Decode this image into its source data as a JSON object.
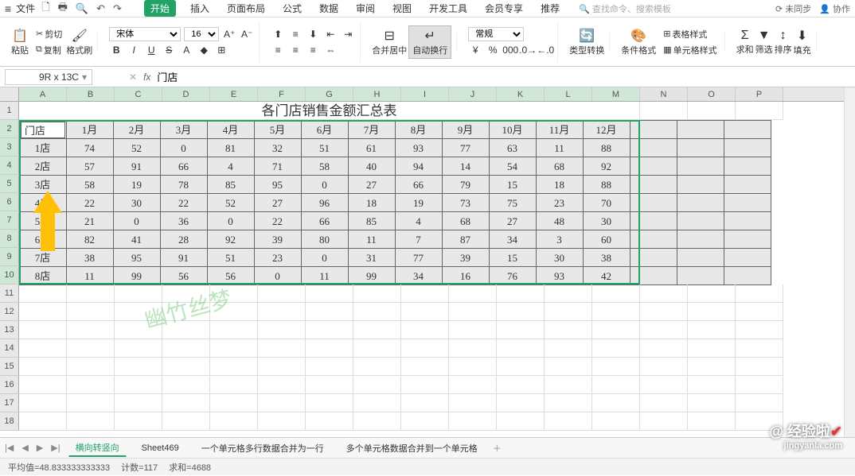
{
  "titlebar": {
    "file": "文件",
    "tabs": [
      "开始",
      "插入",
      "页面布局",
      "公式",
      "数据",
      "审阅",
      "视图",
      "开发工具",
      "会员专享",
      "推荐"
    ],
    "active_tab": 0,
    "search_placeholder": "查找命令、搜索模板",
    "sync": "未同步",
    "collab": "协作"
  },
  "ribbon": {
    "paste": "粘贴",
    "cut": "剪切",
    "copy": "复制",
    "format_painter": "格式刷",
    "font_name": "宋体",
    "font_size": "16",
    "merge": "合并居中",
    "wrap": "自动换行",
    "number_format": "常规",
    "type_convert": "类型转换",
    "cond_format": "条件格式",
    "table_style": "表格样式",
    "cell_style": "单元格样式",
    "sum": "求和",
    "filter": "筛选",
    "sort": "排序",
    "fill": "填充"
  },
  "namebox": "9R x 13C",
  "fx_value": "门店",
  "columns": [
    "A",
    "B",
    "C",
    "D",
    "E",
    "F",
    "G",
    "H",
    "I",
    "J",
    "K",
    "L",
    "M",
    "N",
    "O",
    "P"
  ],
  "selected_cols": 13,
  "title_text": "各门店销售金额汇总表",
  "header_row": [
    "门店",
    "1月",
    "2月",
    "3月",
    "4月",
    "5月",
    "6月",
    "7月",
    "8月",
    "9月",
    "10月",
    "11月",
    "12月"
  ],
  "data_rows": [
    [
      "1店",
      "74",
      "52",
      "0",
      "81",
      "32",
      "51",
      "61",
      "93",
      "77",
      "63",
      "11",
      "88"
    ],
    [
      "2店",
      "57",
      "91",
      "66",
      "4",
      "71",
      "58",
      "40",
      "94",
      "14",
      "54",
      "68",
      "92"
    ],
    [
      "3店",
      "58",
      "19",
      "78",
      "85",
      "95",
      "0",
      "27",
      "66",
      "79",
      "15",
      "18",
      "88"
    ],
    [
      "4店",
      "22",
      "30",
      "22",
      "52",
      "27",
      "96",
      "18",
      "19",
      "73",
      "75",
      "23",
      "70"
    ],
    [
      "5店",
      "21",
      "0",
      "36",
      "0",
      "22",
      "66",
      "85",
      "4",
      "68",
      "27",
      "48",
      "30"
    ],
    [
      "6店",
      "82",
      "41",
      "28",
      "92",
      "39",
      "80",
      "11",
      "7",
      "87",
      "34",
      "3",
      "60"
    ],
    [
      "7店",
      "38",
      "95",
      "91",
      "51",
      "23",
      "0",
      "31",
      "77",
      "39",
      "15",
      "30",
      "38"
    ],
    [
      "8店",
      "11",
      "99",
      "56",
      "56",
      "0",
      "11",
      "99",
      "34",
      "16",
      "76",
      "93",
      "42"
    ]
  ],
  "empty_rows": [
    "11",
    "12",
    "13",
    "14",
    "15",
    "16",
    "17",
    "18"
  ],
  "watermark": "幽竹丝梦",
  "sheets": {
    "active": "横向转竖向",
    "others": [
      "Sheet469",
      "一个单元格多行数据合并为一行",
      "多个单元格数据合并到一个单元格"
    ]
  },
  "status": {
    "avg_label": "平均值",
    "avg": "48.833333333333",
    "count_label": "计数",
    "count": "117",
    "sum_label": "求和",
    "sum": "4688"
  },
  "brand": {
    "main": "@ 经验啦",
    "sub": "jingyanla.com"
  }
}
